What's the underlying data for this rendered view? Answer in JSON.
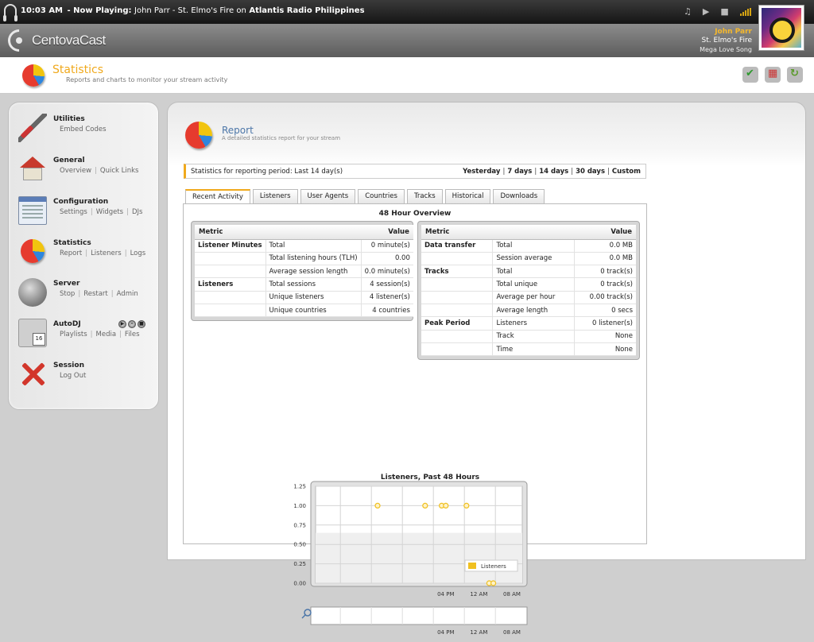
{
  "now_playing": {
    "time": "10:03 AM",
    "prefix": "- Now Playing:",
    "song": "John Parr - St. Elmo's Fire on",
    "station": "Atlantis Radio Philippines"
  },
  "header": {
    "logo_text": "CentovaCast",
    "artist": "John Parr",
    "track_title": "St. Elmo's Fire",
    "album": "Mega Love Song"
  },
  "page": {
    "title": "Statistics",
    "subtitle": "Reports and charts to monitor your stream activity"
  },
  "sidebar": {
    "items": [
      {
        "title": "Utilities",
        "icon": "wrench-icon",
        "links": [
          "Embed Codes"
        ]
      },
      {
        "title": "General",
        "icon": "house-icon",
        "links": [
          "Overview",
          "Quick Links"
        ]
      },
      {
        "title": "Configuration",
        "icon": "settings-window-icon",
        "links": [
          "Settings",
          "Widgets",
          "DJs"
        ]
      },
      {
        "title": "Statistics",
        "icon": "pie-chart-icon",
        "links": [
          "Report",
          "Listeners",
          "Logs"
        ]
      },
      {
        "title": "Server",
        "icon": "speaker-icon",
        "links": [
          "Stop",
          "Restart",
          "Admin"
        ]
      },
      {
        "title": "AutoDJ",
        "icon": "microphone-calendar-icon",
        "links": [
          "Playlists",
          "Media",
          "Files"
        ]
      },
      {
        "title": "Session",
        "icon": "red-x-icon",
        "links": [
          "Log Out"
        ]
      }
    ]
  },
  "report": {
    "title": "Report",
    "subtitle": "A detailed statistics report for your stream",
    "period_label": "Statistics for reporting period: Last 14 day(s)",
    "period_links": [
      "Yesterday",
      "7 days",
      "14 days",
      "30 days",
      "Custom"
    ],
    "tabs": [
      "Recent Activity",
      "Listeners",
      "User Agents",
      "Countries",
      "Tracks",
      "Historical",
      "Downloads"
    ],
    "active_tab": "Recent Activity",
    "overview_title": "48 Hour Overview",
    "left_table": {
      "headers": [
        "Metric",
        "Value"
      ],
      "rows": [
        [
          "Listener Minutes",
          "Total",
          "0 minute(s)"
        ],
        [
          "",
          "Total listening hours (TLH)",
          "0.00"
        ],
        [
          "",
          "Average session length",
          "0.0 minute(s)"
        ],
        [
          "Listeners",
          "Total sessions",
          "4 session(s)"
        ],
        [
          "",
          "Unique listeners",
          "4 listener(s)"
        ],
        [
          "",
          "Unique countries",
          "4 countries"
        ]
      ]
    },
    "right_table": {
      "headers": [
        "Metric",
        "Value"
      ],
      "rows": [
        [
          "Data transfer",
          "Total",
          "0.0 MB"
        ],
        [
          "",
          "Session average",
          "0.0 MB"
        ],
        [
          "Tracks",
          "Total",
          "0 track(s)"
        ],
        [
          "",
          "Total unique",
          "0 track(s)"
        ],
        [
          "",
          "Average per hour",
          "0.00 track(s)"
        ],
        [
          "",
          "Average length",
          "0 secs"
        ],
        [
          "Peak Period",
          "Listeners",
          "0 listener(s)"
        ],
        [
          "",
          "Track",
          "None"
        ],
        [
          "",
          "Time",
          "None"
        ]
      ]
    }
  },
  "chart_data": {
    "type": "scatter",
    "title": "Listeners, Past 48 Hours",
    "xlabel": "",
    "ylabel": "",
    "ylim": [
      0,
      1.25
    ],
    "yticks": [
      "0.00",
      "0.25",
      "0.50",
      "0.75",
      "1.00",
      "1.25"
    ],
    "xticks": [
      "04 PM",
      "12 AM",
      "08 AM"
    ],
    "legend": "bottom-right",
    "series": [
      {
        "name": "Listeners",
        "color": "#f0c020",
        "points": [
          {
            "x": 0.3,
            "y": 1.0
          },
          {
            "x": 0.53,
            "y": 1.0
          },
          {
            "x": 0.61,
            "y": 1.0
          },
          {
            "x": 0.63,
            "y": 1.0
          },
          {
            "x": 0.73,
            "y": 1.0
          },
          {
            "x": 0.84,
            "y": 0.0
          },
          {
            "x": 0.86,
            "y": 0.0
          }
        ]
      }
    ]
  }
}
